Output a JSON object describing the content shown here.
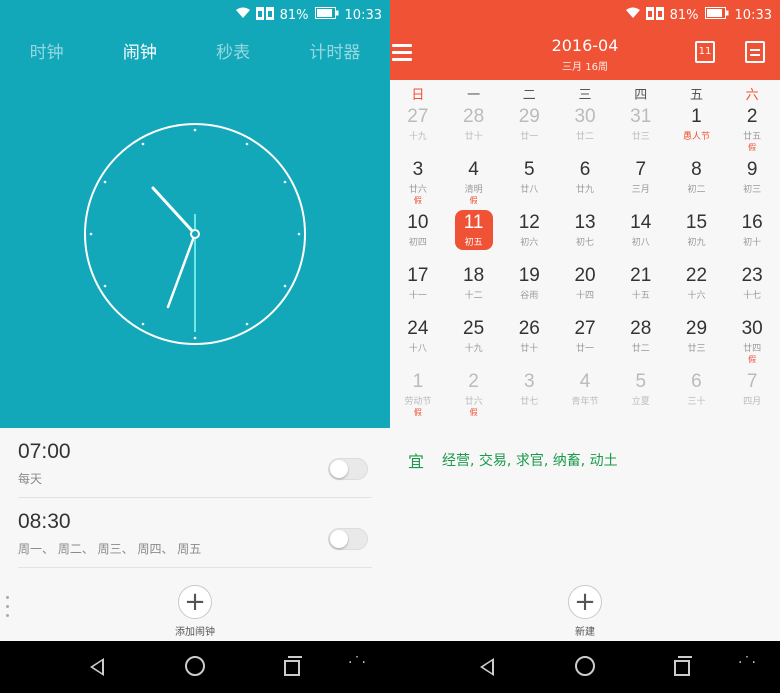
{
  "status_left": {
    "battery": "81%",
    "time": "10:33"
  },
  "status_right": {
    "battery": "81%",
    "time": "10:33"
  },
  "clock_app": {
    "tabs": [
      {
        "label": "时钟"
      },
      {
        "label": "闹钟"
      },
      {
        "label": "秒表"
      },
      {
        "label": "计时器"
      }
    ],
    "active_tab": "闹钟",
    "alarms": [
      {
        "time": "07:00",
        "repeat": "每天",
        "enabled": false
      },
      {
        "time": "08:30",
        "repeat": "周一、 周二、 周三、 周四、 周五",
        "enabled": false
      }
    ],
    "add_label": "添加闹钟",
    "colors": {
      "accent": "#13a8b9"
    }
  },
  "calendar_app": {
    "month_title": "2016-04",
    "month_sub": "三月  16周",
    "today_icon_num": "11",
    "weekdays": [
      "日",
      "一",
      "二",
      "三",
      "四",
      "五",
      "六"
    ],
    "weeks": [
      [
        {
          "d": "27",
          "l": "十九",
          "dim": true
        },
        {
          "d": "28",
          "l": "廿十",
          "dim": true
        },
        {
          "d": "29",
          "l": "廿一",
          "dim": true
        },
        {
          "d": "30",
          "l": "廿二",
          "dim": true
        },
        {
          "d": "31",
          "l": "廿三",
          "dim": true
        },
        {
          "d": "1",
          "l": "愚人节",
          "fest": true
        },
        {
          "d": "2",
          "l": "廿五",
          "tag": "假"
        }
      ],
      [
        {
          "d": "3",
          "l": "廿六",
          "tag": "假"
        },
        {
          "d": "4",
          "l": "清明",
          "tag": "假"
        },
        {
          "d": "5",
          "l": "廿八"
        },
        {
          "d": "6",
          "l": "廿九"
        },
        {
          "d": "7",
          "l": "三月"
        },
        {
          "d": "8",
          "l": "初二"
        },
        {
          "d": "9",
          "l": "初三"
        }
      ],
      [
        {
          "d": "10",
          "l": "初四"
        },
        {
          "d": "11",
          "l": "初五",
          "sel": true
        },
        {
          "d": "12",
          "l": "初六"
        },
        {
          "d": "13",
          "l": "初七"
        },
        {
          "d": "14",
          "l": "初八"
        },
        {
          "d": "15",
          "l": "初九"
        },
        {
          "d": "16",
          "l": "初十"
        }
      ],
      [
        {
          "d": "17",
          "l": "十一"
        },
        {
          "d": "18",
          "l": "十二"
        },
        {
          "d": "19",
          "l": "谷雨"
        },
        {
          "d": "20",
          "l": "十四"
        },
        {
          "d": "21",
          "l": "十五"
        },
        {
          "d": "22",
          "l": "十六"
        },
        {
          "d": "23",
          "l": "十七"
        }
      ],
      [
        {
          "d": "24",
          "l": "十八"
        },
        {
          "d": "25",
          "l": "十九"
        },
        {
          "d": "26",
          "l": "廿十"
        },
        {
          "d": "27",
          "l": "廿一"
        },
        {
          "d": "28",
          "l": "廿二"
        },
        {
          "d": "29",
          "l": "廿三"
        },
        {
          "d": "30",
          "l": "廿四",
          "tag": "假"
        }
      ],
      [
        {
          "d": "1",
          "l": "劳动节",
          "dim": true,
          "tag": "假"
        },
        {
          "d": "2",
          "l": "廿六",
          "dim": true,
          "tag": "假"
        },
        {
          "d": "3",
          "l": "廿七",
          "dim": true
        },
        {
          "d": "4",
          "l": "青年节",
          "dim": true
        },
        {
          "d": "5",
          "l": "立夏",
          "dim": true
        },
        {
          "d": "6",
          "l": "三十",
          "dim": true
        },
        {
          "d": "7",
          "l": "四月",
          "dim": true
        }
      ]
    ],
    "yi_label": "宜",
    "yi_text": "经营, 交易, 求官, 纳畜, 动土",
    "new_label": "新建",
    "colors": {
      "accent": "#ef5235",
      "yi": "#1a9a4a"
    }
  }
}
